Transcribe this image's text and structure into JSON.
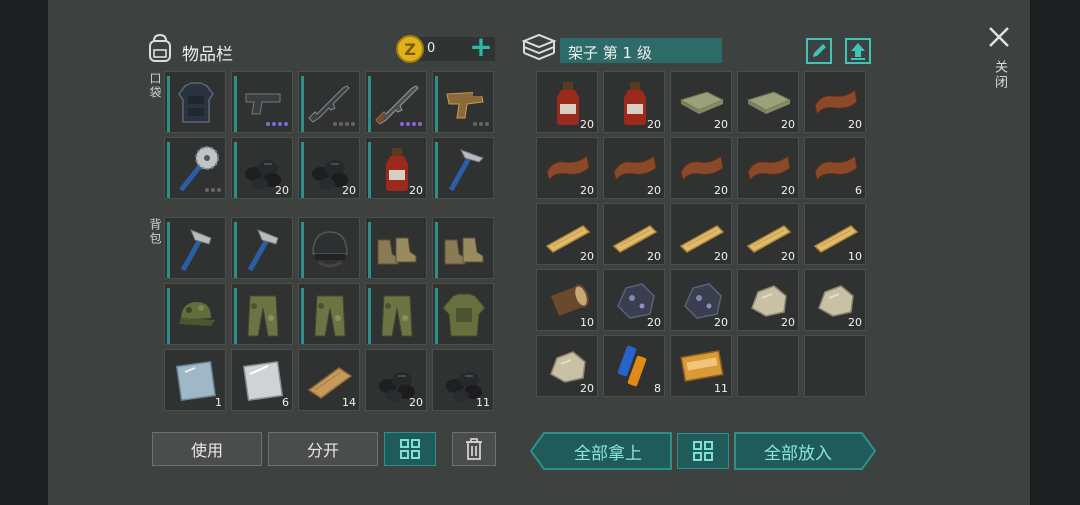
{
  "inventory": {
    "title": "物品栏",
    "coins": "0",
    "pocket_label": "口袋",
    "backpack_label": "背包",
    "pocket_slots": [
      {
        "icon": "armor-vest-icon",
        "count": "",
        "dots": []
      },
      {
        "icon": "pistol-icon",
        "count": "",
        "dots": [
          "#7a6fd6",
          "#7a6fd6",
          "#7a6fd6",
          "#7a6fd6"
        ]
      },
      {
        "icon": "rifle-icon",
        "count": "",
        "dots": [
          "#666",
          "#666",
          "#666",
          "#666"
        ]
      },
      {
        "icon": "ak-rifle-icon",
        "count": "",
        "dots": [
          "#8f64d8",
          "#8f64d8",
          "#8f64d8",
          "#8f64d8"
        ]
      },
      {
        "icon": "flare-gun-icon",
        "count": "",
        "dots": [
          "#666",
          "#666",
          "#666"
        ]
      },
      {
        "icon": "buzzsaw-mace-icon",
        "count": "",
        "dots": [
          "#666",
          "#666",
          "#666"
        ]
      },
      {
        "icon": "coal-icon",
        "count": "20",
        "dots": []
      },
      {
        "icon": "coal-icon",
        "count": "20",
        "dots": []
      },
      {
        "icon": "bottle-icon",
        "count": "20",
        "dots": []
      },
      {
        "icon": "pickaxe-icon",
        "count": "",
        "dots": []
      }
    ],
    "backpack_slots": [
      {
        "icon": "hammer-axe-icon",
        "count": ""
      },
      {
        "icon": "hammer-axe-icon",
        "count": ""
      },
      {
        "icon": "helmet-icon",
        "count": ""
      },
      {
        "icon": "boots-icon",
        "count": ""
      },
      {
        "icon": "boots-icon",
        "count": ""
      },
      {
        "icon": "camo-cap-icon",
        "count": ""
      },
      {
        "icon": "camo-pants-icon",
        "count": ""
      },
      {
        "icon": "camo-pants-icon",
        "count": ""
      },
      {
        "icon": "camo-pants-icon",
        "count": ""
      },
      {
        "icon": "camo-jacket-icon",
        "count": ""
      },
      {
        "icon": "glass-plate-icon",
        "count": "1"
      },
      {
        "icon": "steel-plate-icon",
        "count": "6"
      },
      {
        "icon": "wood-board-icon",
        "count": "14"
      },
      {
        "icon": "coal-icon",
        "count": "20"
      },
      {
        "icon": "coal-icon",
        "count": "11"
      }
    ],
    "use_label": "使用",
    "split_label": "分开"
  },
  "shelf": {
    "title": "架子 第 1 级",
    "slots": [
      {
        "icon": "bottle-icon",
        "count": "20"
      },
      {
        "icon": "bottle-icon",
        "count": "20"
      },
      {
        "icon": "cloth-icon",
        "count": "20"
      },
      {
        "icon": "cloth-icon",
        "count": "20"
      },
      {
        "icon": "leather-icon",
        "count": "20"
      },
      {
        "icon": "leather-icon",
        "count": "20"
      },
      {
        "icon": "leather-icon",
        "count": "20"
      },
      {
        "icon": "leather-icon",
        "count": "20"
      },
      {
        "icon": "leather-icon",
        "count": "20"
      },
      {
        "icon": "leather-icon",
        "count": "6"
      },
      {
        "icon": "plank-icon",
        "count": "20"
      },
      {
        "icon": "plank-icon",
        "count": "20"
      },
      {
        "icon": "plank-icon",
        "count": "20"
      },
      {
        "icon": "plank-icon",
        "count": "20"
      },
      {
        "icon": "plank-icon",
        "count": "10"
      },
      {
        "icon": "log-icon",
        "count": "10"
      },
      {
        "icon": "iron-ore-icon",
        "count": "20"
      },
      {
        "icon": "iron-ore-icon",
        "count": "20"
      },
      {
        "icon": "stone-icon",
        "count": "20"
      },
      {
        "icon": "stone-icon",
        "count": "20"
      },
      {
        "icon": "stone-icon",
        "count": "20"
      },
      {
        "icon": "battery-icon",
        "count": "8"
      },
      {
        "icon": "coupon-icon",
        "count": "11"
      },
      {
        "icon": "",
        "count": ""
      },
      {
        "icon": "",
        "count": ""
      }
    ],
    "take_all_label": "全部拿上",
    "put_all_label": "全部放入"
  },
  "close_label": "关闭",
  "colors": {
    "accent": "#2f8e8a",
    "panel": "#3d413f",
    "slot": "#2f3231",
    "coin": "#e0b21a"
  }
}
